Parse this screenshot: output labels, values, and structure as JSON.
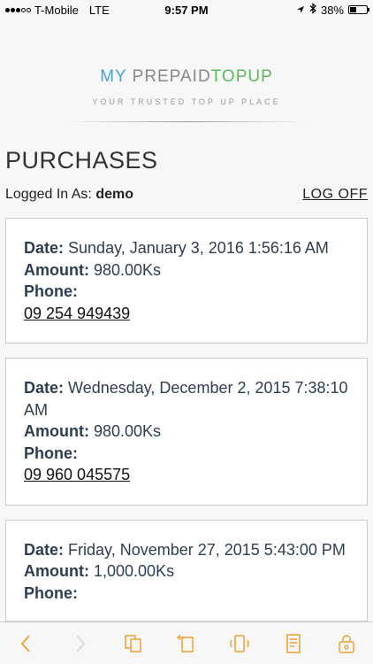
{
  "status_bar": {
    "carrier": "T-Mobile",
    "network": "LTE",
    "time": "9:57 PM",
    "battery": "38%",
    "battery_level": 0.38
  },
  "brand": {
    "title_part1": "MY",
    "title_part2": "PREPAID",
    "title_part3": "TOPUP",
    "tagline": "YOUR TRUSTED TOP UP PLACE",
    "colors": {
      "part1": "#4aa3d5",
      "part2": "#888888",
      "part3": "#5cb85c"
    }
  },
  "page": {
    "title": "PURCHASES",
    "login_label": "Logged In As:",
    "login_user": "demo",
    "logoff_label": "LOG OFF"
  },
  "purchases": [
    {
      "date_label": "Date:",
      "date": "Sunday, January 3, 2016 1:56:16 AM",
      "amount_label": "Amount:",
      "amount": "980.00Ks",
      "phone_label": "Phone:",
      "phone": "09 254 949439"
    },
    {
      "date_label": "Date:",
      "date": "Wednesday, December 2, 2015 7:38:10 AM",
      "amount_label": "Amount:",
      "amount": "980.00Ks",
      "phone_label": "Phone:",
      "phone": "09 960 045575"
    },
    {
      "date_label": "Date:",
      "date": "Friday, November 27, 2015 5:43:00 PM",
      "amount_label": "Amount:",
      "amount": "1,000.00Ks",
      "phone_label": "Phone:"
    }
  ],
  "toolbar": {
    "accent": "#f0a030",
    "icons": [
      "back-icon",
      "forward-icon",
      "pages-icon",
      "new-tab-icon",
      "rotate-icon",
      "reader-icon",
      "lock-icon"
    ]
  }
}
